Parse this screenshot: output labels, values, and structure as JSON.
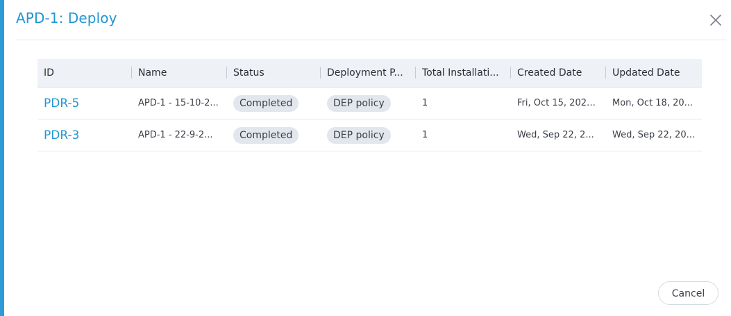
{
  "modal": {
    "title": "APD-1: Deploy",
    "close_icon": "close-icon",
    "cancel_label": "Cancel"
  },
  "table": {
    "columns": [
      "ID",
      "Name",
      "Status",
      "Deployment P...",
      "Total Installati...",
      "Created Date",
      "Updated Date"
    ],
    "rows": [
      {
        "id": "PDR-5",
        "name": "APD-1 - 15-10-2...",
        "status": "Completed",
        "deployment_policy": "DEP policy",
        "total_installations": "1",
        "created_date": "Fri, Oct 15, 2021 ...",
        "updated_date": "Mon, Oct 18, 20..."
      },
      {
        "id": "PDR-3",
        "name": "APD-1 - 22-9-2...",
        "status": "Completed",
        "deployment_policy": "DEP policy",
        "total_installations": "1",
        "created_date": "Wed, Sep 22, 2...",
        "updated_date": "Wed, Sep 22, 20..."
      }
    ]
  },
  "colors": {
    "accent": "#2196d3",
    "left_bar": "#2e9bd6",
    "header_bg": "#eef1f5",
    "chip_bg": "#e2e6ed"
  }
}
